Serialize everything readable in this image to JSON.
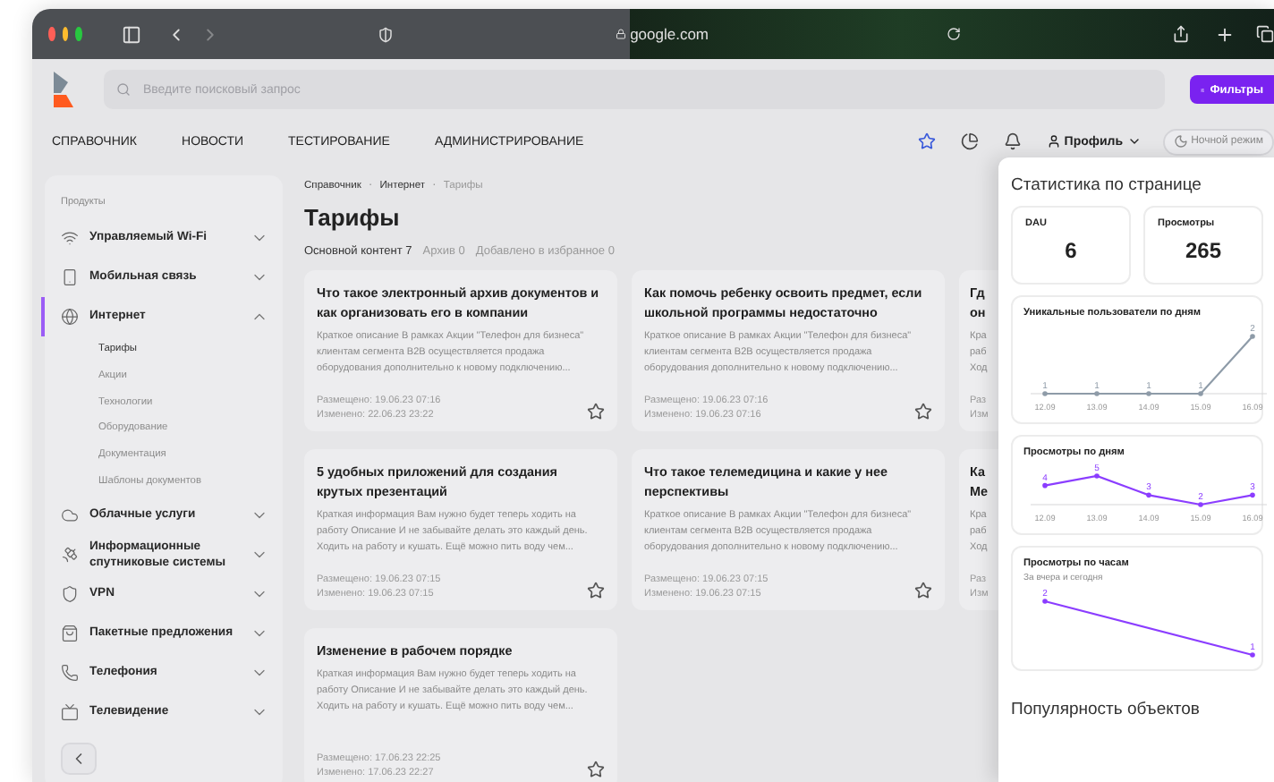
{
  "browser": {
    "address": "google.com"
  },
  "header": {
    "search": {
      "placeholder": "Введите поисковый запрос"
    },
    "filters_button": "Фильтры"
  },
  "nav": {
    "items": [
      {
        "label": "СПРАВОЧНИК"
      },
      {
        "label": "НОВОСТИ"
      },
      {
        "label": "ТЕСТИРОВАНИЕ"
      },
      {
        "label": "АДМИНИСТРИРОВАНИЕ"
      }
    ],
    "profile": "Профиль",
    "night_mode": {
      "label": "Ночной режим",
      "on": false
    }
  },
  "sidebar": {
    "heading": "Продукты",
    "items": [
      {
        "label": "Управляемый Wi-Fi",
        "expanded": false,
        "selected": false
      },
      {
        "label": "Мобильная связь",
        "expanded": false,
        "selected": false
      },
      {
        "label": "Интернет",
        "expanded": true,
        "selected": true,
        "children": [
          {
            "label": "Тарифы",
            "selected": true
          },
          {
            "label": "Акции",
            "selected": false
          },
          {
            "label": "Технологии",
            "selected": false
          },
          {
            "label": "Оборудование",
            "selected": false
          },
          {
            "label": "Документация",
            "selected": false
          },
          {
            "label": "Шаблоны документов",
            "selected": false
          }
        ]
      },
      {
        "label": "Облачные услуги",
        "expanded": false,
        "selected": false
      },
      {
        "label": "Информационные спутниковые системы",
        "expanded": false,
        "selected": false
      },
      {
        "label": "VPN",
        "expanded": false,
        "selected": false
      },
      {
        "label": "Пакетные предложения",
        "expanded": false,
        "selected": false
      },
      {
        "label": "Телефония",
        "expanded": false,
        "selected": false
      },
      {
        "label": "Телевидение",
        "expanded": false,
        "selected": false
      }
    ]
  },
  "breadcrumb": [
    "Справочник",
    "Интернет",
    "Тарифы"
  ],
  "breadcrumb_separator": "·",
  "page_title": "Тарифы",
  "tabs": [
    {
      "label": "Основной контент 7",
      "selected": true
    },
    {
      "label": "Архив 0",
      "selected": false
    },
    {
      "label": "Добавлено в избранное 0",
      "selected": false
    }
  ],
  "cards": [
    {
      "title": "Что такое электронный архив документов и как организовать его в компании",
      "description": "Краткое описание В рамках Акции \"Телефон для бизнеса\" клиентам сегмента B2B осуществляется продажа оборудования дополнительно к новому подключению...",
      "posted": "Размещено: 19.06.23 07:16",
      "changed": "Изменено: 22.06.23 23:22",
      "favorite": false
    },
    {
      "title": "Как помочь ребенку освоить предмет, если школьной программы недостаточно",
      "description": "Краткое описание В рамках Акции \"Телефон для бизнеса\" клиентам сегмента B2B осуществляется продажа оборудования дополнительно к новому подключению...",
      "posted": "Размещено: 19.06.23 07:16",
      "changed": "Изменено: 19.06.23 07:16",
      "favorite": false
    },
    {
      "title": "Гд он",
      "description": "Кра раб Ход",
      "posted": "Раз",
      "changed": "Изм"
    },
    {
      "title": "5 удобных приложений для создания крутых презентаций",
      "description": "Краткая информация Вам нужно будет теперь ходить на работу Описание И не забывайте делать это каждый день. Ходить на работу и кушать. Ещё можно пить воду чем...",
      "posted": "Размещено: 19.06.23 07:15",
      "changed": "Изменено: 19.06.23 07:15",
      "favorite": false
    },
    {
      "title": "Что такое телемедицина и какие у нее перспективы",
      "description": "Краткое описание В рамках Акции \"Телефон для бизнеса\" клиентам сегмента B2B осуществляется продажа оборудования дополнительно к новому подключению...",
      "posted": "Размещено: 19.06.23 07:15",
      "changed": "Изменено: 19.06.23 07:15",
      "favorite": false
    },
    {
      "title": "Ка Ме",
      "description": "Кра раб Ход",
      "posted": "Раз",
      "changed": "Изм"
    },
    {
      "title": "Изменение в рабочем порядке",
      "description": "Краткая информация Вам нужно будет теперь ходить на работу Описание И не забывайте делать это каждый день. Ходить на работу и кушать. Ещё можно пить воду чем...",
      "posted": "Размещено: 17.06.23 22:25",
      "changed": "Изменено: 17.06.23 22:27",
      "favorite": false
    }
  ],
  "stats": {
    "title": "Статистика по странице",
    "metrics": [
      {
        "label": "DAU",
        "value": "6"
      },
      {
        "label": "Просмотры",
        "value": "265"
      }
    ],
    "charts": [
      {
        "title": "Уникальные пользователи по дням",
        "chart_data": {
          "type": "line",
          "categories": [
            "12.09",
            "13.09",
            "14.09",
            "15.09",
            "16.09"
          ],
          "series": [
            {
              "color": "#8e9ba8",
              "values": [
                1,
                1,
                1,
                1,
                2
              ]
            }
          ],
          "data_labels": true
        }
      },
      {
        "title": "Просмотры по дням",
        "chart_data": {
          "type": "line",
          "categories": [
            "12.09",
            "13.09",
            "14.09",
            "15.09",
            "16.09"
          ],
          "series": [
            {
              "color": "#8b3dff",
              "values": [
                4,
                5,
                3,
                2,
                3
              ]
            }
          ],
          "data_labels": true
        }
      },
      {
        "title": "Просмотры по часам",
        "subtitle": "За вчера и сегодня",
        "chart_data": {
          "type": "line",
          "series": [
            {
              "color": "#8b3dff",
              "values": [
                2,
                1
              ]
            }
          ],
          "data_labels": true
        }
      }
    ],
    "popularity_title": "Популярность объектов"
  }
}
